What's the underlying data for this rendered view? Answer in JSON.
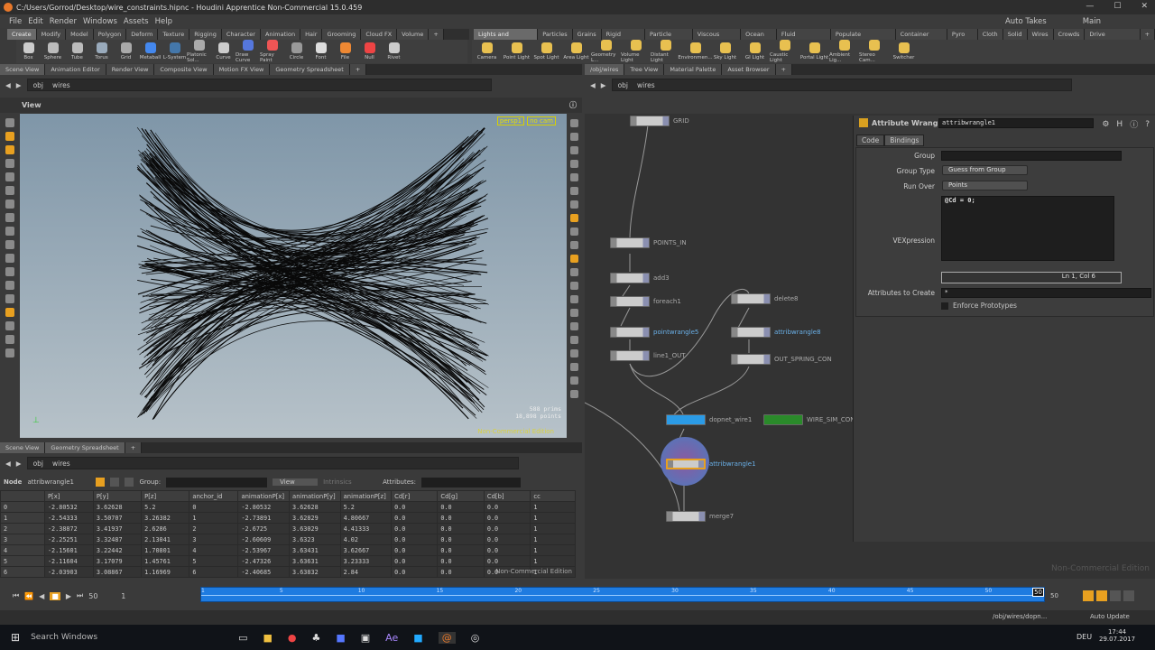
{
  "window": {
    "title": "C:/Users/Gorrod/Desktop/wire_constraints.hipnc - Houdini Apprentice Non-Commercial 15.0.459"
  },
  "menu": [
    "File",
    "Edit",
    "Render",
    "Windows",
    "Assets",
    "Help"
  ],
  "menu_right": {
    "auto_takes": "Auto Takes",
    "desktop": "Main"
  },
  "shelf_left": {
    "tabs": [
      "Create",
      "Modify",
      "Model",
      "Polygon",
      "Deform",
      "Texture",
      "Rigging",
      "Character",
      "Animation",
      "Hair",
      "Grooming",
      "Cloud FX",
      "Volume",
      "+"
    ],
    "tools": [
      "Box",
      "Sphere",
      "Tube",
      "Torus",
      "Grid",
      "Metaball",
      "L-System",
      "Platonic Sol...",
      "Curve",
      "Draw Curve",
      "Spray Paint",
      "Circle",
      "Font",
      "File",
      "Null",
      "Rivet"
    ]
  },
  "shelf_right": {
    "tabs": [
      "Lights and Cameras",
      "Particles",
      "Grains",
      "Rigid Bodies",
      "Particle Fluids",
      "Viscous Fluids",
      "Ocean FX",
      "Fluid Containers",
      "Populate Containers",
      "Container Tools",
      "Pyro FX",
      "Cloth",
      "Solid",
      "Wires",
      "Crowds",
      "Drive Simulation",
      "+"
    ],
    "tools": [
      "Camera",
      "Point Light",
      "Spot Light",
      "Area Light",
      "Geometry L...",
      "Volume Light",
      "Distant Light",
      "Environmen...",
      "Sky Light",
      "GI Light",
      "Caustic Light",
      "Portal Light",
      "Ambient Lig...",
      "Stereo Cam...",
      "Switcher"
    ]
  },
  "left_pane_tabs": [
    "Scene View",
    "Animation Editor",
    "Render View",
    "Composite View",
    "Motion FX View",
    "Geometry Spreadsheet",
    "+"
  ],
  "right_pane_tabs": [
    "/obj/wires",
    "Tree View",
    "Material Palette",
    "Asset Browser",
    "+"
  ],
  "path": {
    "root": "obj",
    "child": "wires"
  },
  "viewport": {
    "header": "View",
    "camera": "persp1",
    "cam_menu": "no cam",
    "prims": "588  prims",
    "points": "18,898 points",
    "watermark": "Non-Commercial Edition"
  },
  "spreadsheet": {
    "tabs": [
      "Scene View",
      "Geometry Spreadsheet",
      "+"
    ],
    "node_label": "Node",
    "node": "attribwrangle1",
    "group_label": "Group:",
    "view": "View",
    "intrinsics": "Intrinsics",
    "attributes_label": "Attributes:",
    "columns": [
      "",
      "P[x]",
      "P[y]",
      "P[z]",
      "anchor_id",
      "animationP[x]",
      "animationP[y]",
      "animationP[z]",
      "Cd[r]",
      "Cd[g]",
      "Cd[b]",
      "cc"
    ],
    "rows": [
      [
        "0",
        "-2.80532",
        "3.62628",
        "5.2",
        "0",
        "-2.80532",
        "3.62628",
        "5.2",
        "0.0",
        "0.0",
        "0.0",
        "1"
      ],
      [
        "1",
        "-2.54333",
        "3.50707",
        "3.26382",
        "1",
        "-2.73891",
        "3.62829",
        "4.80667",
        "0.0",
        "0.0",
        "0.0",
        "1"
      ],
      [
        "2",
        "-2.38872",
        "3.41937",
        "2.6286",
        "2",
        "-2.6725",
        "3.63029",
        "4.41333",
        "0.0",
        "0.0",
        "0.0",
        "1"
      ],
      [
        "3",
        "-2.25251",
        "3.32487",
        "2.13041",
        "3",
        "-2.60609",
        "3.6323",
        "4.02",
        "0.0",
        "0.0",
        "0.0",
        "1"
      ],
      [
        "4",
        "-2.15601",
        "3.22442",
        "1.70801",
        "4",
        "-2.53967",
        "3.63431",
        "3.62667",
        "0.0",
        "0.0",
        "0.0",
        "1"
      ],
      [
        "5",
        "-2.11604",
        "3.17079",
        "1.45761",
        "5",
        "-2.47326",
        "3.63631",
        "3.23333",
        "0.0",
        "0.0",
        "0.0",
        "1"
      ],
      [
        "6",
        "-2.03903",
        "3.08867",
        "1.16969",
        "6",
        "-2.40685",
        "3.63832",
        "2.84",
        "0.0",
        "0.0",
        "0.0",
        "1"
      ]
    ],
    "watermark": "Non-Commercial Edition"
  },
  "network": {
    "nodes": [
      {
        "name": "GRID",
        "color": "#aaa"
      },
      {
        "name": "POINTS_IN",
        "color": "#aaa"
      },
      {
        "name": "add3",
        "color": "#aaa"
      },
      {
        "name": "foreach1",
        "color": "#aaa"
      },
      {
        "name": "pointwrangle5",
        "color": "#6ab0e8"
      },
      {
        "name": "line1_OUT",
        "color": "#aaa"
      },
      {
        "name": "delete8",
        "color": "#aaa"
      },
      {
        "name": "attribwrangle8",
        "color": "#6ab0e8"
      },
      {
        "name": "OUT_SPRING_CON",
        "color": "#aaa"
      },
      {
        "name": "dopnet_wire1",
        "color": "#aaa"
      },
      {
        "name": "WIRE_SIM_CON",
        "color": "#aaa"
      },
      {
        "name": "attribwrangle1",
        "color": "#6ab0e8"
      },
      {
        "name": "merge7",
        "color": "#aaa"
      }
    ]
  },
  "params": {
    "type": "Attribute Wrangle",
    "name": "attribwrangle1",
    "tabs": [
      "Code",
      "Bindings"
    ],
    "group_label": "Group",
    "group": "",
    "group_type_label": "Group Type",
    "group_type": "Guess from Group",
    "run_over_label": "Run Over",
    "run_over": "Points",
    "vex_label": "VEXpression",
    "vex": "@Cd = 0;",
    "cursor": "Ln 1, Col 6",
    "attrs_label": "Attributes to Create",
    "attrs": "*",
    "enforce_label": "Enforce Prototypes",
    "watermark": "Non-Commercial Edition"
  },
  "timeline": {
    "frame": "1",
    "start": "50",
    "end": "50",
    "current": "50",
    "ticks": [
      "1",
      "5",
      "10",
      "15",
      "20",
      "25",
      "30",
      "35",
      "40",
      "45",
      "50"
    ],
    "progress": 1.0
  },
  "status": {
    "path": "/obj/wires/dopn...",
    "update": "Auto Update"
  },
  "taskbar": {
    "search": "Search Windows",
    "lang": "DEU",
    "time": "17:44",
    "date": "29.07.2017"
  },
  "colors": {
    "accent": "#e8a020",
    "timeline": "#1e7be0",
    "selected": "#2b8fe6"
  }
}
